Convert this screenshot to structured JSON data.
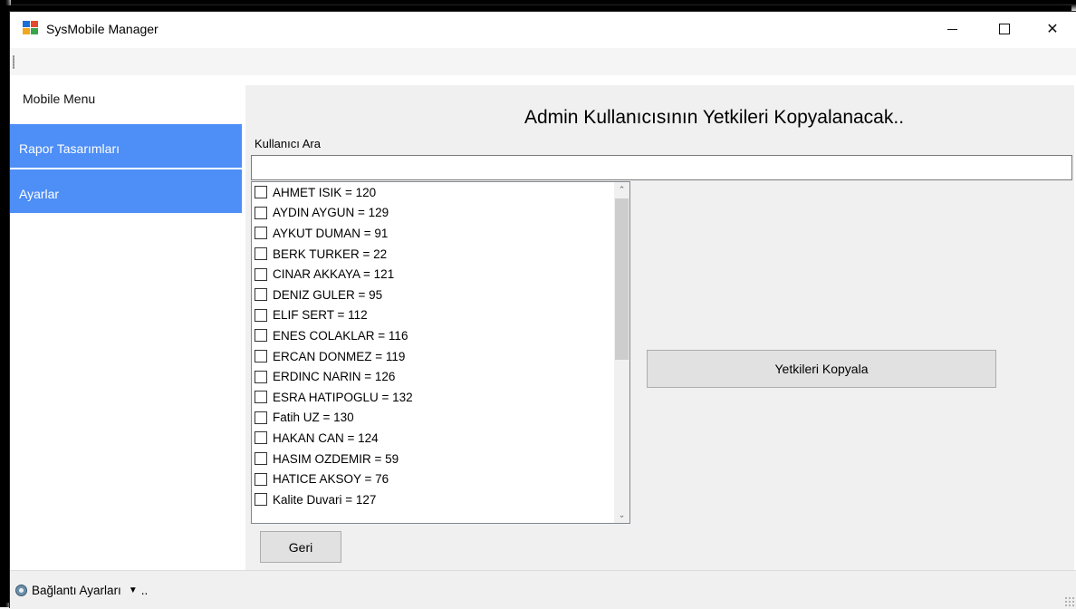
{
  "window": {
    "title": "SysMobile Manager",
    "minimize_icon": "minimize-icon",
    "maximize_icon": "maximize-icon",
    "close_icon": "close-icon",
    "close_glyph": "✕"
  },
  "sidebar": {
    "title": "Mobile Menu",
    "accent_color": "#4d8ef7",
    "items": [
      {
        "label": "Rapor Tasarımları"
      },
      {
        "label": "Ayarlar"
      }
    ]
  },
  "main": {
    "heading": "Admin Kullanıcısının Yetkileri Kopyalanacak..",
    "search": {
      "label": "Kullanıcı Ara",
      "value": "",
      "placeholder": ""
    },
    "users": [
      {
        "label": "AHMET ISIK = 120",
        "checked": false
      },
      {
        "label": "AYDIN AYGUN = 129",
        "checked": false
      },
      {
        "label": "AYKUT DUMAN = 91",
        "checked": false
      },
      {
        "label": "BERK TURKER = 22",
        "checked": false
      },
      {
        "label": "CINAR AKKAYA = 121",
        "checked": false
      },
      {
        "label": "DENIZ GULER = 95",
        "checked": false
      },
      {
        "label": "ELIF SERT = 112",
        "checked": false
      },
      {
        "label": "ENES COLAKLAR = 116",
        "checked": false
      },
      {
        "label": "ERCAN DONMEZ = 119",
        "checked": false
      },
      {
        "label": "ERDINC NARIN = 126",
        "checked": false
      },
      {
        "label": "ESRA HATIPOGLU = 132",
        "checked": false
      },
      {
        "label": "Fatih UZ = 130",
        "checked": false
      },
      {
        "label": "HAKAN CAN = 124",
        "checked": false
      },
      {
        "label": "HASIM OZDEMIR = 59",
        "checked": false
      },
      {
        "label": "HATICE AKSOY = 76",
        "checked": false
      },
      {
        "label": "Kalite Duvari = 127",
        "checked": false
      }
    ],
    "scroll_up_glyph": "⌃",
    "scroll_down_glyph": "⌄",
    "copy_button": "Yetkileri Kopyala",
    "back_button": "Geri"
  },
  "status": {
    "dropdown_label": "Bağlantı Ayarları",
    "dropdown_arrow": "▼",
    "dropdown_tail": "..",
    "icon": "settings-gear-icon"
  }
}
